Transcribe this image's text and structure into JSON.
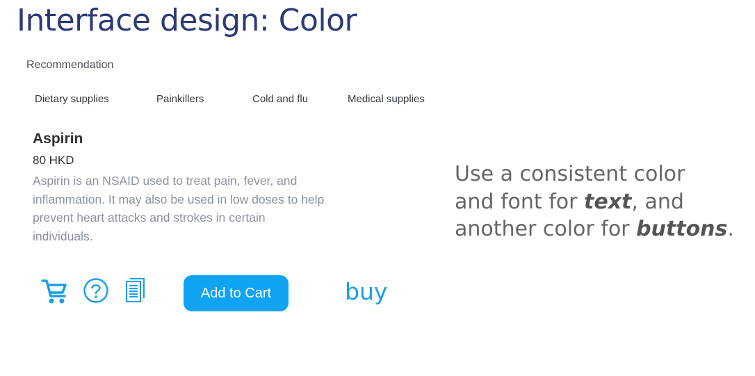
{
  "slide": {
    "title": "Interface design: Color"
  },
  "recommendation": {
    "label": "Recommendation",
    "tabs": [
      "Dietary supplies",
      "Painkillers",
      "Cold and flu",
      "Medical supplies"
    ]
  },
  "product": {
    "name": "Aspirin",
    "price": "80 HKD",
    "description": "Aspirin is an NSAID used to treat pain, fever, and inflammation. It may also be used in low doses to help prevent heart attacks and strokes in certain individuals."
  },
  "actions": {
    "icons": [
      "cart-icon",
      "help-icon",
      "document-icon"
    ],
    "add_to_cart_label": "Add to Cart",
    "buy_label": "buy"
  },
  "note": {
    "line1": "Use a consistent color",
    "line2_pre": "and font for ",
    "line2_emph": "text",
    "line2_post": ", and",
    "line3_pre": "another color for ",
    "line3_emph": "buttons",
    "line3_post": "."
  },
  "colors": {
    "title": "#2b3a78",
    "accent": "#0fa3f2",
    "link": "#1a9fe6",
    "description": "#8a91a0"
  }
}
